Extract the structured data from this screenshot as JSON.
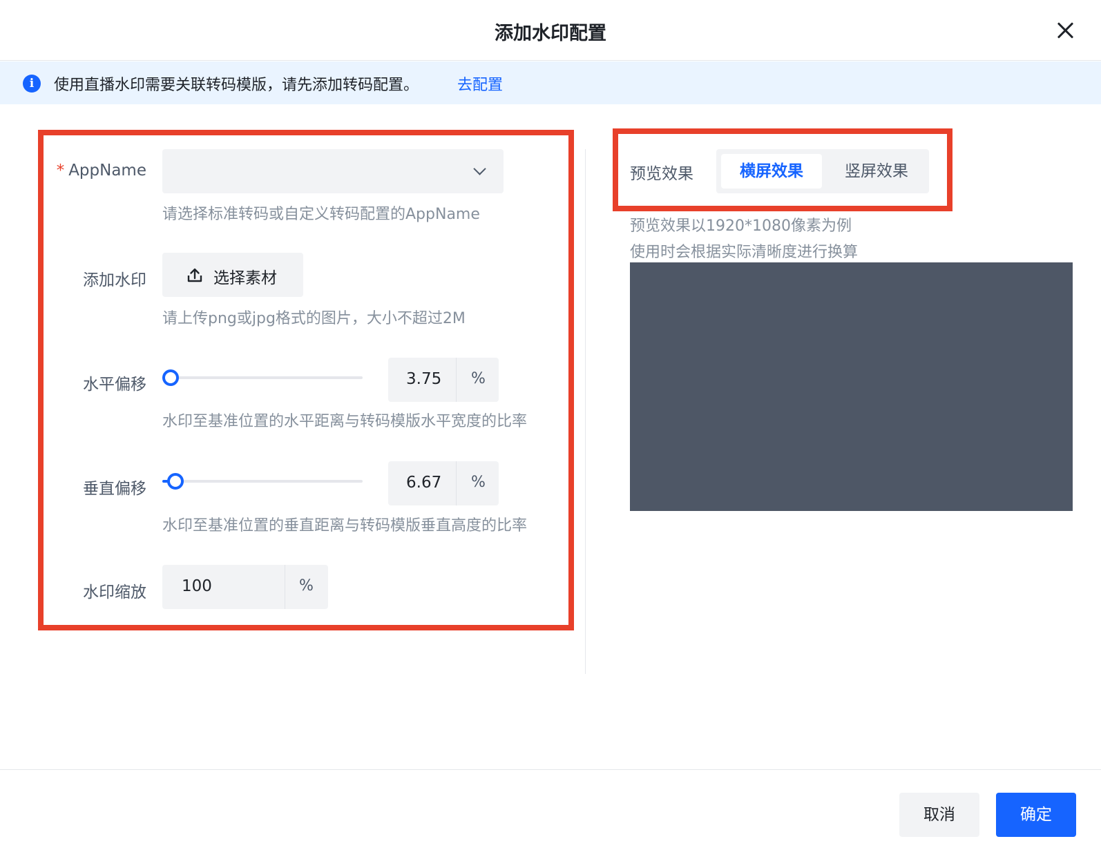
{
  "dialog": {
    "title": "添加水印配置",
    "close_icon": "close-icon"
  },
  "notice": {
    "icon": "info-icon",
    "icon_glyph": "i",
    "text": "使用直播水印需要关联转码模版，请先添加转码配置。",
    "link": "去配置"
  },
  "form": {
    "appname": {
      "required_mark": "*",
      "label": "AppName",
      "value": "",
      "hint": "请选择标准转码或自定义转码配置的AppName"
    },
    "watermark": {
      "label": "添加水印",
      "button": "选择素材",
      "button_icon": "upload-icon",
      "hint": "请上传png或jpg格式的图片，大小不超过2M"
    },
    "h_offset": {
      "label": "水平偏移",
      "value": "3.75",
      "unit": "%",
      "hint": "水印至基准位置的水平距离与转码模版水平宽度的比率",
      "slider_fraction": 0.0375
    },
    "v_offset": {
      "label": "垂直偏移",
      "value": "6.67",
      "unit": "%",
      "hint": "水印至基准位置的垂直距离与转码模版垂直高度的比率",
      "slider_fraction": 0.0667
    },
    "scale": {
      "label": "水印缩放",
      "value": "100",
      "unit": "%"
    }
  },
  "preview": {
    "label": "预览效果",
    "tabs": [
      {
        "label": "横屏效果",
        "active": true
      },
      {
        "label": "竖屏效果",
        "active": false
      }
    ],
    "note1": "预览效果以1920*1080像素为例",
    "note2": "使用时会根据实际清晰度进行换算"
  },
  "footer": {
    "cancel": "取消",
    "confirm": "确定"
  },
  "colors": {
    "accent": "#1664ff",
    "highlight_box": "#e8402a",
    "notice_bg": "#eaf4ff",
    "preview_bg": "#4e5766"
  }
}
